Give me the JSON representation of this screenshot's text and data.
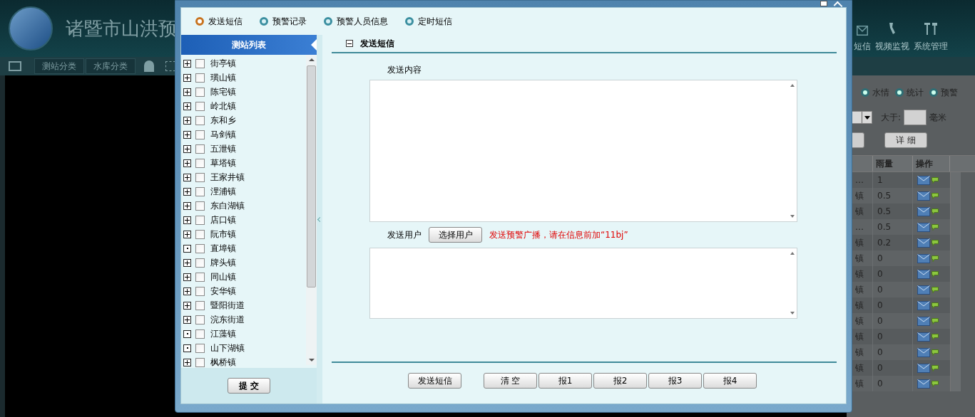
{
  "app": {
    "title": "诸暨市山洪预",
    "toolbar": [
      "测站分类",
      "水库分类"
    ],
    "nav": [
      {
        "label": "短信"
      },
      {
        "label": "视频监视"
      },
      {
        "label": "系统管理"
      }
    ],
    "filter_tabs": [
      {
        "label": "水情",
        "selected": false
      },
      {
        "label": "统计",
        "selected": false
      },
      {
        "label": "预警",
        "selected": false
      }
    ],
    "filter": {
      "more_than_label": "大于:",
      "unit": "毫米",
      "detail_button": "详 细"
    },
    "table": {
      "columns": [
        "雨量",
        "操作"
      ],
      "rows": [
        {
          "town": "…",
          "rainfall": "1"
        },
        {
          "town": "镇",
          "rainfall": "0.5"
        },
        {
          "town": "镇",
          "rainfall": "0.5"
        },
        {
          "town": "…",
          "rainfall": "0.5"
        },
        {
          "town": "镇",
          "rainfall": "0.2"
        },
        {
          "town": "镇",
          "rainfall": "0"
        },
        {
          "town": "镇",
          "rainfall": "0"
        },
        {
          "town": "镇",
          "rainfall": "0"
        },
        {
          "town": "镇",
          "rainfall": "0"
        },
        {
          "town": "镇",
          "rainfall": "0"
        },
        {
          "town": "镇",
          "rainfall": "0"
        },
        {
          "town": "镇",
          "rainfall": "0"
        },
        {
          "town": "镇",
          "rainfall": "0"
        },
        {
          "town": "镇",
          "rainfall": "0"
        }
      ]
    }
  },
  "dialog": {
    "tabs": [
      {
        "label": "发送短信",
        "selected": true
      },
      {
        "label": "预警记录",
        "selected": false
      },
      {
        "label": "预警人员信息",
        "selected": false
      },
      {
        "label": "定时短信",
        "selected": false
      }
    ],
    "station_list": {
      "title": "测站列表",
      "items": [
        {
          "label": "街亭镇",
          "expandable": true,
          "checked": false
        },
        {
          "label": "璜山镇",
          "expandable": true,
          "checked": false
        },
        {
          "label": "陈宅镇",
          "expandable": true,
          "checked": false
        },
        {
          "label": "岭北镇",
          "expandable": true,
          "checked": false
        },
        {
          "label": "东和乡",
          "expandable": true,
          "checked": false
        },
        {
          "label": "马剑镇",
          "expandable": true,
          "checked": false
        },
        {
          "label": "五泄镇",
          "expandable": true,
          "checked": false
        },
        {
          "label": "草塔镇",
          "expandable": true,
          "checked": false
        },
        {
          "label": "王家井镇",
          "expandable": true,
          "checked": false
        },
        {
          "label": "浬浦镇",
          "expandable": true,
          "checked": false
        },
        {
          "label": "东白湖镇",
          "expandable": true,
          "checked": false
        },
        {
          "label": "店口镇",
          "expandable": true,
          "checked": false
        },
        {
          "label": "阮市镇",
          "expandable": true,
          "checked": false
        },
        {
          "label": "直埠镇",
          "expandable": false,
          "checked": false
        },
        {
          "label": "牌头镇",
          "expandable": true,
          "checked": false
        },
        {
          "label": "同山镇",
          "expandable": true,
          "checked": false
        },
        {
          "label": "安华镇",
          "expandable": true,
          "checked": false
        },
        {
          "label": "暨阳街道",
          "expandable": true,
          "checked": false
        },
        {
          "label": "浣东街道",
          "expandable": true,
          "checked": false
        },
        {
          "label": "江藻镇",
          "expandable": false,
          "checked": false
        },
        {
          "label": "山下湖镇",
          "expandable": false,
          "checked": false
        },
        {
          "label": "枫桥镇",
          "expandable": true,
          "checked": false
        }
      ]
    },
    "submit_button": "提 交",
    "section_title": "发送短信",
    "content_label": "发送内容",
    "users_label": "发送用户",
    "select_users_button": "选择用户",
    "hint": "发送预警广播，请在信息前加“11bj”",
    "buttons": [
      "发送短信",
      "清 空",
      "报1",
      "报2",
      "报3",
      "报4"
    ]
  }
}
